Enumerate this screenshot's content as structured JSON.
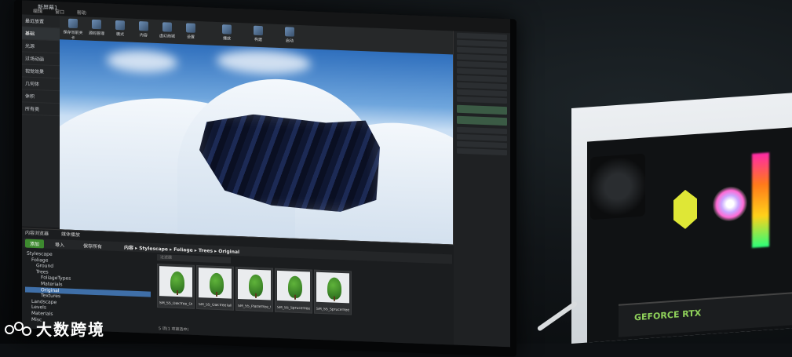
{
  "editor": {
    "window_title": "新屏幕1",
    "menu": [
      "编辑",
      "窗口",
      "帮助"
    ],
    "modes": [
      "最近放置",
      "基础",
      "光源",
      "过场动画",
      "视觉效果",
      "几何体",
      "体积",
      "所有类"
    ],
    "toolbar": [
      "保存当前关卡",
      "源码管理",
      "模式",
      "内容",
      "虚幻商城",
      "设置",
      "播放",
      "构建",
      "启动"
    ],
    "content_browser": {
      "tabs": [
        "内容浏览器",
        "媒体播放"
      ],
      "add_label": "添加",
      "import_label": "导入",
      "save_all_label": "保存所有",
      "path": [
        "内容",
        "Stylescape",
        "Foliage",
        "Trees",
        "Original"
      ],
      "search_placeholder": "过滤器",
      "folders": [
        "Stylescape",
        "Foliage",
        "Ground",
        "Trees",
        "FoliageTypes",
        "Materials",
        "Original",
        "Textures",
        "Landscape",
        "Levels",
        "Materials",
        "Misc"
      ],
      "selected_folder": "Original",
      "assets": [
        "SM_SS_OakTree_Original",
        "SM_SS_OakTreeTall_Original",
        "SM_SS_PlatleTree_Original",
        "SM_SS_SpruceTree_Original",
        "SM_SS_SpruceTreeTall_Original"
      ],
      "status": "5 项(1 项被选中)"
    }
  },
  "pc": {
    "gpu_label": "GEFORCE RTX"
  },
  "watermark": {
    "text": "大数跨境"
  }
}
